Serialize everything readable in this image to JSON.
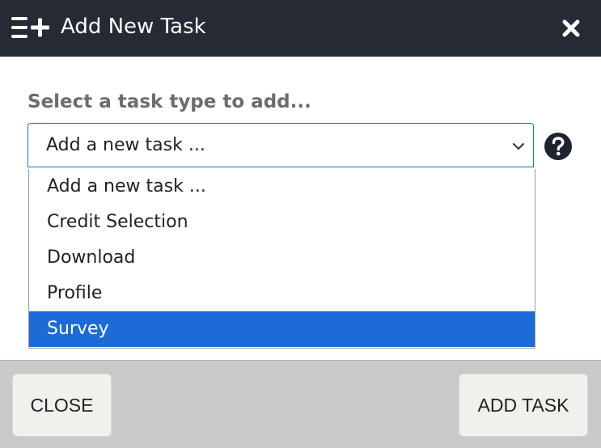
{
  "dialog": {
    "title": "Add New Task",
    "header_icon": "list-add-icon",
    "close_icon": "close-icon"
  },
  "form": {
    "prompt": "Select a task type to add...",
    "select": {
      "value": "Add a new task ...",
      "icon": "chevron-down-icon"
    },
    "help_icon": "question-circle-icon",
    "options": [
      {
        "label": "Add a new task ...",
        "selected": false
      },
      {
        "label": "Credit Selection",
        "selected": false
      },
      {
        "label": "Download",
        "selected": false
      },
      {
        "label": "Profile",
        "selected": false
      },
      {
        "label": "Survey",
        "selected": true
      }
    ]
  },
  "footer": {
    "close_label": "CLOSE",
    "add_label": "ADD TASK"
  },
  "colors": {
    "header_bg": "#262a35",
    "highlight": "#1c6bd6",
    "select_border": "#1a73c4",
    "footer_bg": "#c9c9c9"
  }
}
